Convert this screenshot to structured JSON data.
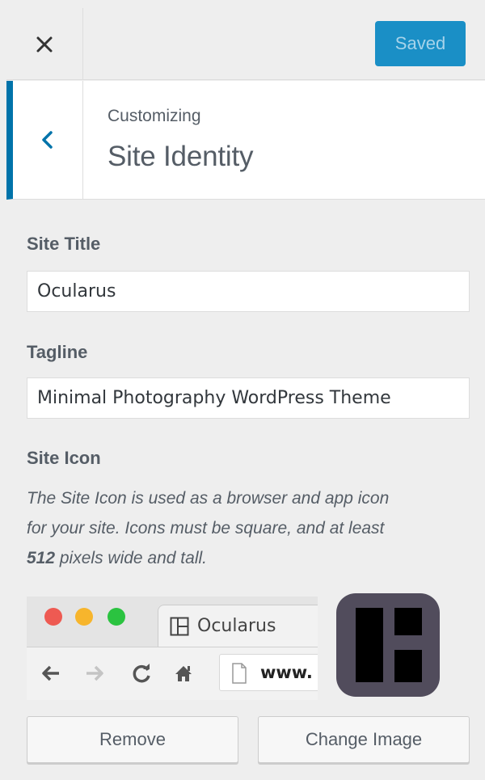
{
  "header": {
    "close_icon": "close-icon",
    "save_button_label": "Saved"
  },
  "section": {
    "breadcrumb": "Customizing",
    "title": "Site Identity",
    "back_icon": "chevron-left-icon"
  },
  "fields": {
    "site_title": {
      "label": "Site Title",
      "value": "Ocularus"
    },
    "tagline": {
      "label": "Tagline",
      "value": "Minimal Photography WordPress Theme"
    }
  },
  "site_icon": {
    "label": "Site Icon",
    "description_line1": "The Site Icon is used as a browser and app icon",
    "description_line2": "for your site. Icons must be square, and at least",
    "description_number": "512",
    "description_rest": " pixels wide and tall.",
    "preview": {
      "tab_title": "Ocularus",
      "url": "www."
    },
    "remove_label": "Remove",
    "change_label": "Change Image"
  },
  "colors": {
    "accent": "#0073aa",
    "saved_button_bg": "#1a8fc6",
    "panel_bg": "#eeeeee"
  }
}
